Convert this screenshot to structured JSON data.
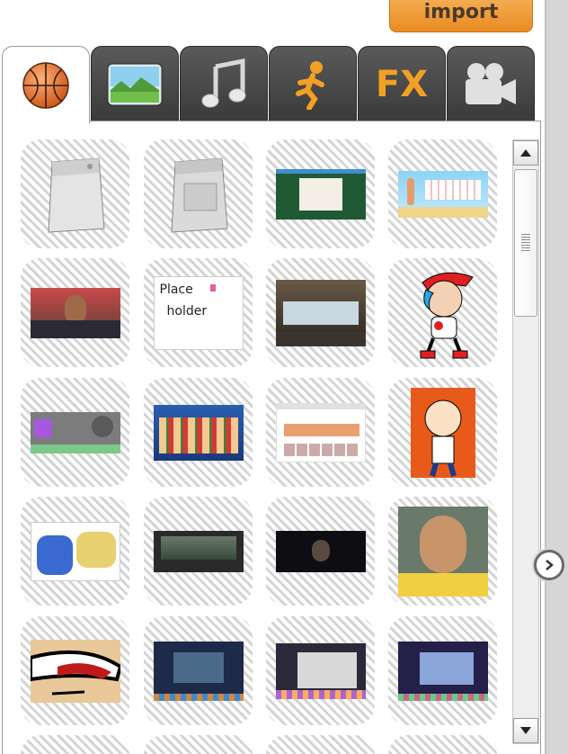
{
  "import_label": "import",
  "tabs": [
    {
      "name": "props",
      "icon": "basketball-icon",
      "active": true
    },
    {
      "name": "backgrounds",
      "icon": "landscape-icon",
      "active": false
    },
    {
      "name": "sounds",
      "icon": "music-note-icon",
      "active": false
    },
    {
      "name": "characters",
      "icon": "running-person-icon",
      "active": false
    },
    {
      "name": "effects",
      "icon": "fx-icon",
      "label": "FX",
      "active": false
    },
    {
      "name": "video",
      "icon": "video-camera-icon",
      "active": false
    }
  ],
  "assets": [
    {
      "desc": "washing-machine"
    },
    {
      "desc": "dryer"
    },
    {
      "desc": "webpage-green"
    },
    {
      "desc": "cartoon-beach-board"
    },
    {
      "desc": "class-photo"
    },
    {
      "desc": "placeholder-drawing",
      "text": "Place holder"
    },
    {
      "desc": "mall-storefront"
    },
    {
      "desc": "cartoon-boy-red-cap"
    },
    {
      "desc": "purple-profile-card"
    },
    {
      "desc": "cartoon-group"
    },
    {
      "desc": "video-site-screenshot"
    },
    {
      "desc": "cartoon-boy-orange"
    },
    {
      "desc": "comic-strip"
    },
    {
      "desc": "dashcam-road"
    },
    {
      "desc": "dark-film-face"
    },
    {
      "desc": "portrait-boy"
    },
    {
      "desc": "cartoon-closeup-face"
    },
    {
      "desc": "editor-screenshot-1"
    },
    {
      "desc": "editor-screenshot-2"
    },
    {
      "desc": "editor-screenshot-3"
    }
  ],
  "colors": {
    "accent": "#e98b22",
    "tab_dark": "#3a3a3a",
    "gutter": "#d6d6d6"
  }
}
